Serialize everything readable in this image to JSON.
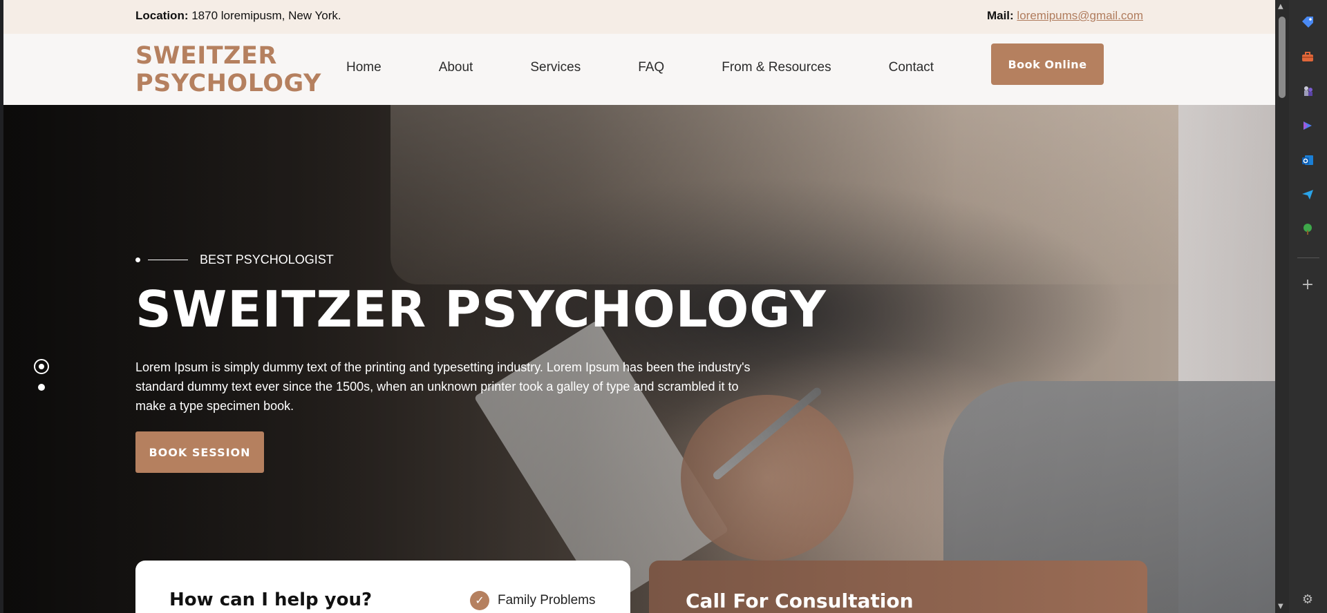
{
  "topbar": {
    "location_label": "Location:",
    "location_value": " 1870 loremipusm, New York.",
    "mail_label": "Mail:",
    "mail_value": "loremipums@gmail.com"
  },
  "header": {
    "logo_line1": "SWEITZER",
    "logo_line2": "PSYCHOLOGY",
    "nav": [
      "Home",
      "About",
      "Services",
      "FAQ",
      "From & Resources",
      "Contact"
    ],
    "book_online": "Book Online"
  },
  "hero": {
    "eyebrow": "BEST PSYCHOLOGIST",
    "title": "SWEITZER PSYCHOLOGY",
    "description": "Lorem Ipsum is simply dummy text of the printing and typesetting industry. Lorem Ipsum has been the industry's standard dummy text ever since the 1500s, when an unknown printer took a galley of type and scrambled it to make a type specimen book.",
    "cta": "BOOK SESSION"
  },
  "cards": {
    "help_title": "How can I help you?",
    "help_item": "Family Problems",
    "consult_title": "Call For Consultation"
  },
  "sidebar_icons": [
    "tag-icon",
    "toolbox-icon",
    "chess-icon",
    "copilot-icon",
    "outlook-icon",
    "send-icon",
    "tree-icon",
    "add-icon",
    "settings-icon"
  ],
  "colors": {
    "accent": "#b5805f",
    "topbar_bg": "#f5ede6",
    "header_bg": "#f8f6f5"
  }
}
